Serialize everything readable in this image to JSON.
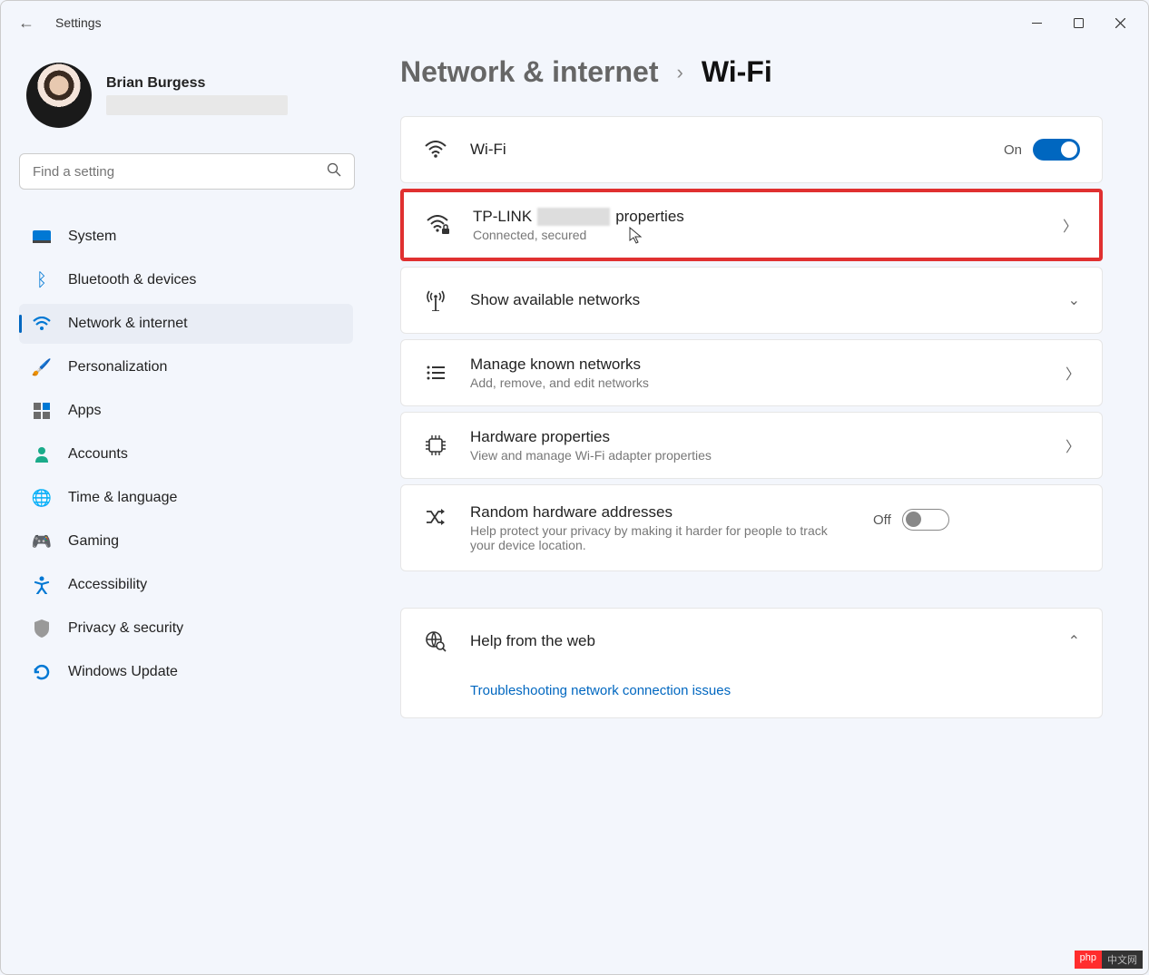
{
  "app": {
    "title": "Settings"
  },
  "user": {
    "name": "Brian Burgess"
  },
  "search": {
    "placeholder": "Find a setting"
  },
  "sidebar": {
    "items": [
      {
        "label": "System"
      },
      {
        "label": "Bluetooth & devices"
      },
      {
        "label": "Network & internet"
      },
      {
        "label": "Personalization"
      },
      {
        "label": "Apps"
      },
      {
        "label": "Accounts"
      },
      {
        "label": "Time & language"
      },
      {
        "label": "Gaming"
      },
      {
        "label": "Accessibility"
      },
      {
        "label": "Privacy & security"
      },
      {
        "label": "Windows Update"
      }
    ]
  },
  "breadcrumb": {
    "parent": "Network & internet",
    "current": "Wi-Fi"
  },
  "wifi_toggle": {
    "title": "Wi-Fi",
    "state_label": "On"
  },
  "network_props": {
    "ssid_prefix": "TP-LINK",
    "title_suffix": "properties",
    "sub": "Connected, secured"
  },
  "available": {
    "title": "Show available networks"
  },
  "known": {
    "title": "Manage known networks",
    "sub": "Add, remove, and edit networks"
  },
  "hardware": {
    "title": "Hardware properties",
    "sub": "View and manage Wi-Fi adapter properties"
  },
  "random": {
    "title": "Random hardware addresses",
    "sub": "Help protect your privacy by making it harder for people to track your device location.",
    "state_label": "Off"
  },
  "help": {
    "title": "Help from the web",
    "link1": "Troubleshooting network connection issues"
  },
  "badge": {
    "left": "php",
    "right": "中文网"
  }
}
